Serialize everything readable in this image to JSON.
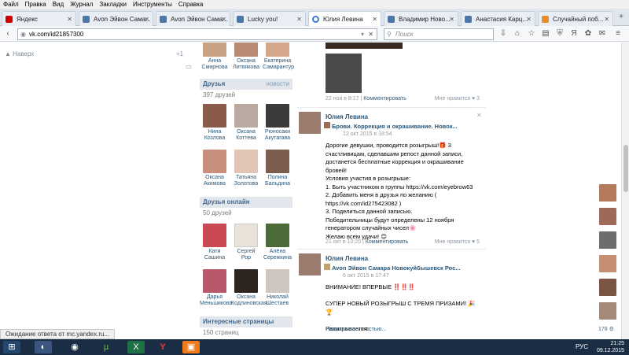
{
  "menubar": [
    "Файл",
    "Правка",
    "Вид",
    "Журнал",
    "Закладки",
    "Инструменты",
    "Справка"
  ],
  "tabs": [
    {
      "label": "Яндекс",
      "color": "#cc0000",
      "active": false
    },
    {
      "label": "Avon Эйвон Сама...",
      "color": "#4a76a8",
      "active": false
    },
    {
      "label": "Avon Эйвон Сама...",
      "color": "#4a76a8",
      "active": false
    },
    {
      "label": "Lucky you!",
      "color": "#4a76a8",
      "active": false
    },
    {
      "label": "Юлия Левина",
      "color": "#3c7dd1",
      "active": true
    },
    {
      "label": "Владимир Ново...",
      "color": "#4a76a8",
      "active": false
    },
    {
      "label": "Анастасия Карц...",
      "color": "#4a76a8",
      "active": false
    },
    {
      "label": "Случайный поб...",
      "color": "#e88d2a",
      "active": false
    }
  ],
  "address": {
    "url": "vk.com/id21857300",
    "search_placeholder": "Поиск"
  },
  "left_gutter": {
    "back_link": "▲ Наверх",
    "counter": "+1"
  },
  "top_people": [
    {
      "name": "Анна\nСмирнова",
      "color": "#c9a183"
    },
    {
      "name": "Оксана\nЛитвякова",
      "color": "#b88a73"
    },
    {
      "name": "Екатерина\nСамарантур",
      "color": "#d4a78c"
    }
  ],
  "friends": {
    "title": "Друзья",
    "more": "новости",
    "count": "397 друзей",
    "people": [
      {
        "name": "Нина\nКозлова",
        "color": "#8a5a4a"
      },
      {
        "name": "Оксана\nКоттева",
        "color": "#b9a9a1"
      },
      {
        "name": "Рюносаки\nАкутагава",
        "color": "#3c3b3a"
      },
      {
        "name": "Оксана\nАкимова",
        "color": "#c98f7d"
      },
      {
        "name": "Татьяна\nЗолотова",
        "color": "#e1c5b5"
      },
      {
        "name": "Полина\nБальдина",
        "color": "#7c5e4e"
      }
    ]
  },
  "online": {
    "title": "Друзья онлайн",
    "count": "50 друзей",
    "people": [
      {
        "name": "Катя\nСашина",
        "color": "#c94a52"
      },
      {
        "name": "Сергей\nРор",
        "color": "#e9e2d8"
      },
      {
        "name": "Алёна\nСережкина",
        "color": "#4d6b38"
      },
      {
        "name": "Дарья\nМеньшикова",
        "color": "#b7596a"
      },
      {
        "name": "Оксана\nКодлиновская",
        "color": "#2e2420"
      },
      {
        "name": "Николай\nШестаев",
        "color": "#cfc7bf"
      }
    ]
  },
  "interesting": {
    "title": "Интересные страницы",
    "count": "150 страниц"
  },
  "posts": [
    {
      "date_line": "22 ноя в 8:17",
      "comment": "Комментировать",
      "like": "Мне нравится",
      "likes": "3"
    },
    {
      "author": "Юлия Левина",
      "repost_title": "Брови. Коррекция и окрашивание. Новок...",
      "repost_date": "12 окт 2015 в 18:54",
      "text": "Дорогие девушки, проводится розыгрыш!🎁 3 счастливицам, сделавшим репост данной записи, достанется бесплатные коррекция и окрашивание бровей!\nУсловия участия в розыгрыше:\n1. Быть участником в группы https://vk.com/eyebrow63\n2. Добавить меня в друзья по желанию ( https://vk.com/id275423082 )\n3. Поделиться данной записью.\nПобедительницы будут определены 12 ноября генератором случайных чисел🌸\nЖелаю всем удачи! 😊",
      "date_line": "21 окт в 10:20",
      "comment": "Комментировать",
      "like": "Мне нравится",
      "likes": "5"
    },
    {
      "author": "Юлия Левина",
      "repost_title": "Avon Эйвон Самара Новокуйбышевск Рос...",
      "repost_date": "6 окт 2015 в 17:47",
      "text": "ВНИМАНИЕ! ВПЕРВЫЕ ‼️‼️‼️\n\nСУПЕР НОВЫЙ РОЗЫГРЫШ С ТРЕМЯ ПРИЗАМИ! 🎉 🏆\n\nРазыгрывается:",
      "show_more": "Показать полностью..."
    }
  ],
  "right_strip": {
    "colors": [
      "#b47a5c",
      "#9c6a56",
      "#6b6e6a",
      "#c58f74",
      "#7a5444",
      "#a48a7a"
    ],
    "count": "178"
  },
  "status": "Ожидание ответа от mc.yandex.ru...",
  "taskbar": {
    "lang": "РУС",
    "time": "21:25",
    "date": "09.12.2015",
    "apps": [
      {
        "icon": "⊞",
        "color": "#1a2d44"
      },
      {
        "icon": "🦊",
        "color": "#e66000"
      },
      {
        "icon": "◉",
        "color": "#2f9e44"
      },
      {
        "icon": "µ",
        "color": "#3f8d2b"
      },
      {
        "icon": "X",
        "color": "#1e7145"
      },
      {
        "icon": "Y",
        "color": "#d11f1f"
      },
      {
        "icon": "▣",
        "color": "#f07b1a"
      }
    ]
  }
}
